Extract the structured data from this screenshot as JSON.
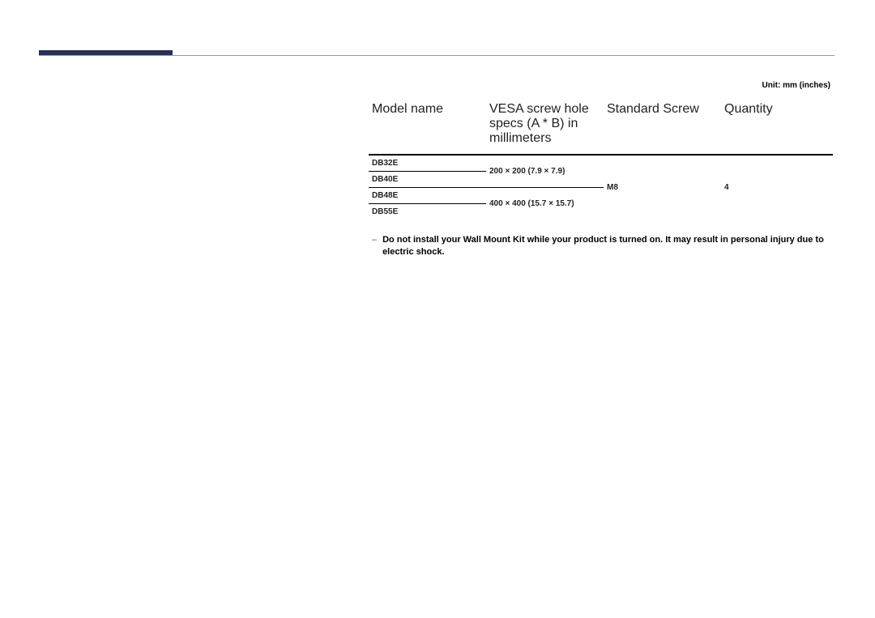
{
  "unit_label": "Unit: mm (inches)",
  "headers": {
    "model": "Model name",
    "vesa": "VESA screw hole specs (A * B) in millimeters",
    "screw": "Standard Screw",
    "qty": "Quantity"
  },
  "rows": {
    "r1_model": "DB32E",
    "r1_2_vesa": "200 × 200 (7.9 × 7.9)",
    "r2_model": "DB40E",
    "screw_all": "M8",
    "qty_all": "4",
    "r3_model": "DB48E",
    "r3_4_vesa": "400 × 400 (15.7 × 15.7)",
    "r4_model": "DB55E"
  },
  "warning": "Do not install your Wall Mount Kit while your product is turned on. It may result in personal injury due to electric shock."
}
